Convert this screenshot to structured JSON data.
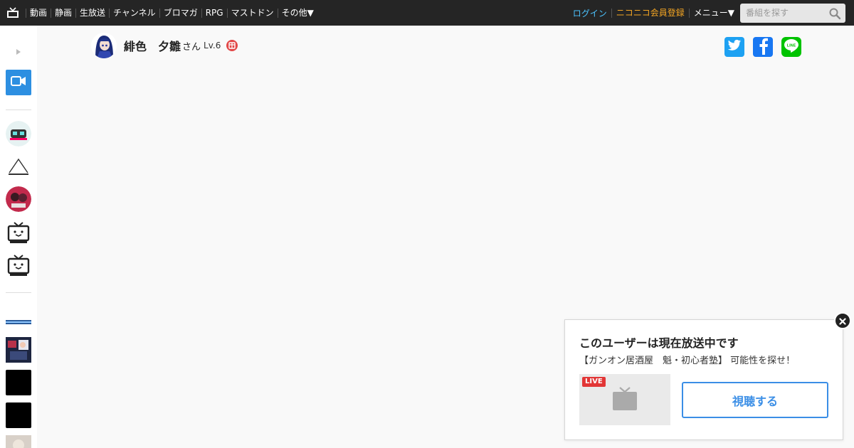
{
  "header": {
    "nav": [
      "動画",
      "静画",
      "生放送",
      "チャンネル",
      "ブロマガ",
      "RPG",
      "マストドン",
      "その他▼"
    ],
    "login": "ログイン",
    "register": "ニコニコ会員登録",
    "menu": "メニュー▼",
    "search_placeholder": "番組を探す"
  },
  "profile": {
    "name": "緋色　夕雛",
    "honorific": "さん",
    "level": "Lv.6",
    "badge": "百"
  },
  "share": {
    "twitter_color": "#1da1f2",
    "facebook_color": "#1877f2",
    "line_color": "#00c300"
  },
  "popup": {
    "title": "このユーザーは現在放送中です",
    "program": "【ガンオン居酒屋　魁・初心者塾】 可能性を探せ！",
    "live_tag": "LIVE",
    "watch_label": "視聴する"
  },
  "colors": {
    "accent": "#2d8fe1",
    "live": "#e23636"
  }
}
